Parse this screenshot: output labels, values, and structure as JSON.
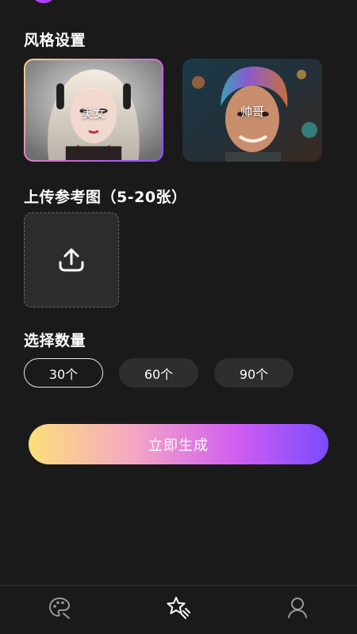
{
  "style_section": {
    "title": "风格设置",
    "cards": [
      {
        "label": "美女",
        "selected": true
      },
      {
        "label": "帅哥",
        "selected": false
      }
    ]
  },
  "upload_section": {
    "title": "上传参考图（5-20张）",
    "upload_icon": "upload-icon"
  },
  "count_section": {
    "title": "选择数量",
    "options": [
      {
        "label": "30个",
        "selected": true
      },
      {
        "label": "60个",
        "selected": false
      },
      {
        "label": "90个",
        "selected": false
      }
    ]
  },
  "generate_button": {
    "label": "立即生成"
  },
  "tabbar": {
    "tabs": [
      {
        "icon": "palette-icon",
        "active": false
      },
      {
        "icon": "sparkle-star-icon",
        "active": true
      },
      {
        "icon": "user-icon",
        "active": false
      }
    ]
  },
  "colors": {
    "background": "#1a1a1a",
    "gradient_start": "#fbe07a",
    "gradient_mid": "#d05cf2",
    "gradient_end": "#7a4cff"
  }
}
